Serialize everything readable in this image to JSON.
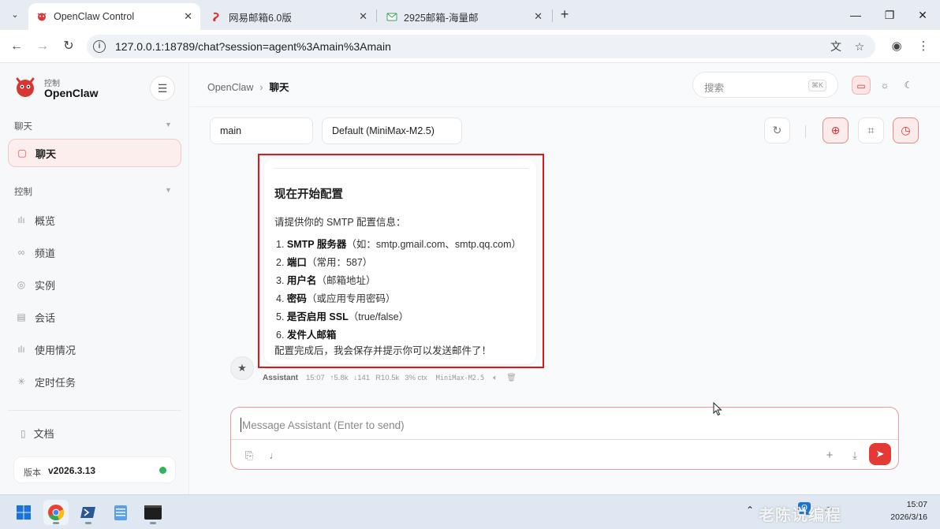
{
  "browser": {
    "tabs": [
      {
        "label": "OpenClaw Control",
        "icon": "openclaw-logo",
        "active": true
      },
      {
        "label": "网易邮箱6.0版",
        "icon": "netease-mail-icon",
        "active": false
      },
      {
        "label": "2925邮箱-海量邮",
        "icon": "mail-envelope-icon",
        "active": false
      }
    ],
    "url": "127.0.0.1:18789/chat?session=agent%3Amain%3Amain"
  },
  "sidebar": {
    "brand_sub": "控制",
    "brand_title": "OpenClaw",
    "section_chat": "聊天",
    "chat_item": "聊天",
    "section_control": "控制",
    "items": [
      {
        "label": "概览",
        "icon": "bar-chart-icon"
      },
      {
        "label": "频道",
        "icon": "link-icon"
      },
      {
        "label": "实例",
        "icon": "radio-icon"
      },
      {
        "label": "会话",
        "icon": "document-icon"
      },
      {
        "label": "使用情况",
        "icon": "bar-chart-icon"
      },
      {
        "label": "定时任务",
        "icon": "spark-icon"
      }
    ],
    "docs": "文档",
    "version_label": "版本",
    "version_value": "v2026.3.13"
  },
  "header": {
    "breadcrumb_root": "OpenClaw",
    "breadcrumb_current": "聊天",
    "search_placeholder": "搜索",
    "search_shortcut": "⌘K"
  },
  "chat_controls": {
    "session": "main",
    "model": "Default (MiniMax-M2.5)"
  },
  "message": {
    "heading": "现在开始配置",
    "intro": "请提供你的 SMTP 配置信息：",
    "items": [
      {
        "num": "1.",
        "bold": "SMTP 服务器",
        "rest": "（如：smtp.gmail.com、smtp.qq.com）"
      },
      {
        "num": "2.",
        "bold": "端口",
        "rest": "（常用：587）"
      },
      {
        "num": "3.",
        "bold": "用户名",
        "rest": "（邮箱地址）"
      },
      {
        "num": "4.",
        "bold": "密码",
        "rest": "（或应用专用密码）"
      },
      {
        "num": "5.",
        "bold": "是否启用 SSL",
        "rest": "（true/false）"
      },
      {
        "num": "6.",
        "bold": "发件人邮箱",
        "rest": ""
      }
    ],
    "outro": "配置完成后，我会保存并提示你可以发送邮件了！",
    "meta": {
      "sender": "Assistant",
      "time": "15:07",
      "up": "↑5.8k",
      "down": "↓141",
      "r": "R10.5k",
      "ctx": "3% ctx",
      "model": "MiniMax-M2.5"
    }
  },
  "composer": {
    "placeholder": "Message Assistant (Enter to send)"
  },
  "taskbar": {
    "time": "15:07",
    "date": "2026/3/16",
    "watermark": "老陈说编程"
  },
  "colors": {
    "accent": "#e53935",
    "highlight_box": "#e0161b",
    "status_online": "#2fb45a"
  }
}
